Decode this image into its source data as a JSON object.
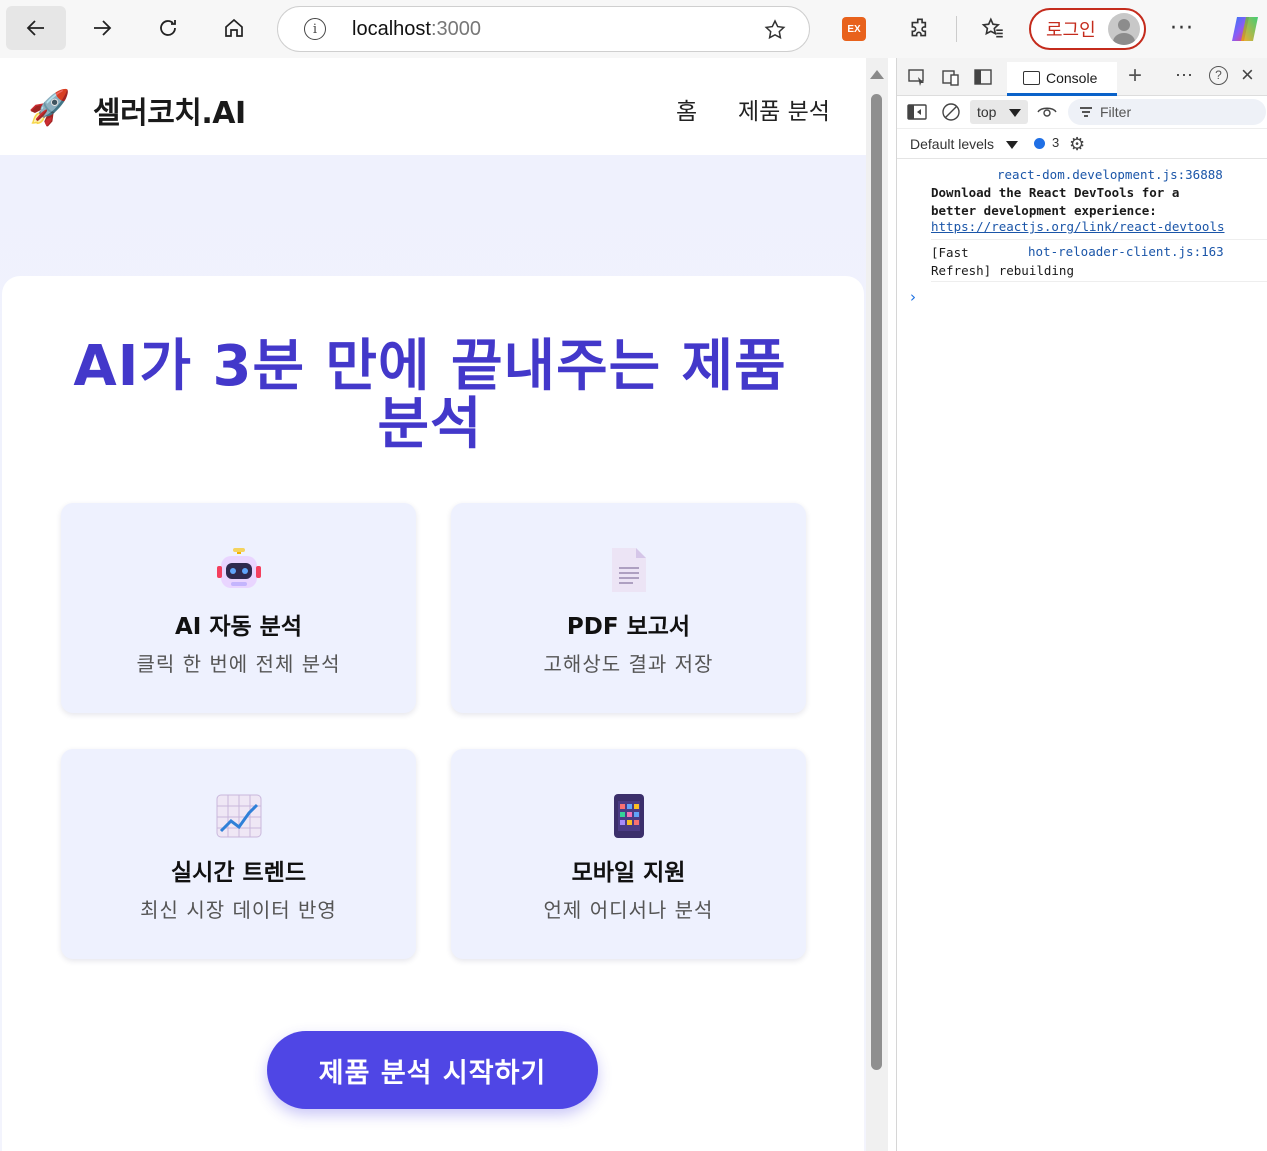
{
  "browser": {
    "url_host": "localhost",
    "url_port": ":3000",
    "ext_badge": "EX",
    "login_label": "로그인",
    "more_label": "···"
  },
  "page": {
    "brand": "셀러코치.AI",
    "logo_emoji": "🚀",
    "nav": {
      "home": "홈",
      "analysis": "제품 분석"
    },
    "hero_title": "AI가 3분 만에 끝내주는 제품 분석",
    "features": [
      {
        "icon": "🤖",
        "icon_name": "robot-icon",
        "title": "AI 자동 분석",
        "desc": "클릭 한 번에 전체 분석"
      },
      {
        "icon": "📄",
        "icon_name": "document-icon",
        "title": "PDF 보고서",
        "desc": "고해상도 결과 저장"
      },
      {
        "icon": "📈",
        "icon_name": "chart-increasing-icon",
        "title": "실시간 트렌드",
        "desc": "최신 시장 데이터 반영"
      },
      {
        "icon": "📱",
        "icon_name": "mobile-phone-icon",
        "title": "모바일 지원",
        "desc": "언제 어디서나 분석"
      }
    ],
    "cta_label": "제품 분석 시작하기"
  },
  "devtools": {
    "console_tab": "Console",
    "context": "top",
    "filter_placeholder": "Filter",
    "levels": "Default levels",
    "message_count": "3",
    "messages": [
      {
        "source": "react-dom.development.js:36888",
        "text": "Download the React DevTools for a\nbetter development experience:",
        "link": "https://reactjs.org/link/react-devtools"
      },
      {
        "source": "hot-reloader-client.js:163",
        "text_line1": "[Fast",
        "text_line2": "Refresh] rebuilding"
      }
    ],
    "prompt": "›"
  },
  "colors": {
    "accent": "#4f46e5",
    "hero_title": "#4338ca",
    "card_bg": "#eef1fe",
    "login_border": "#c42b1c"
  }
}
